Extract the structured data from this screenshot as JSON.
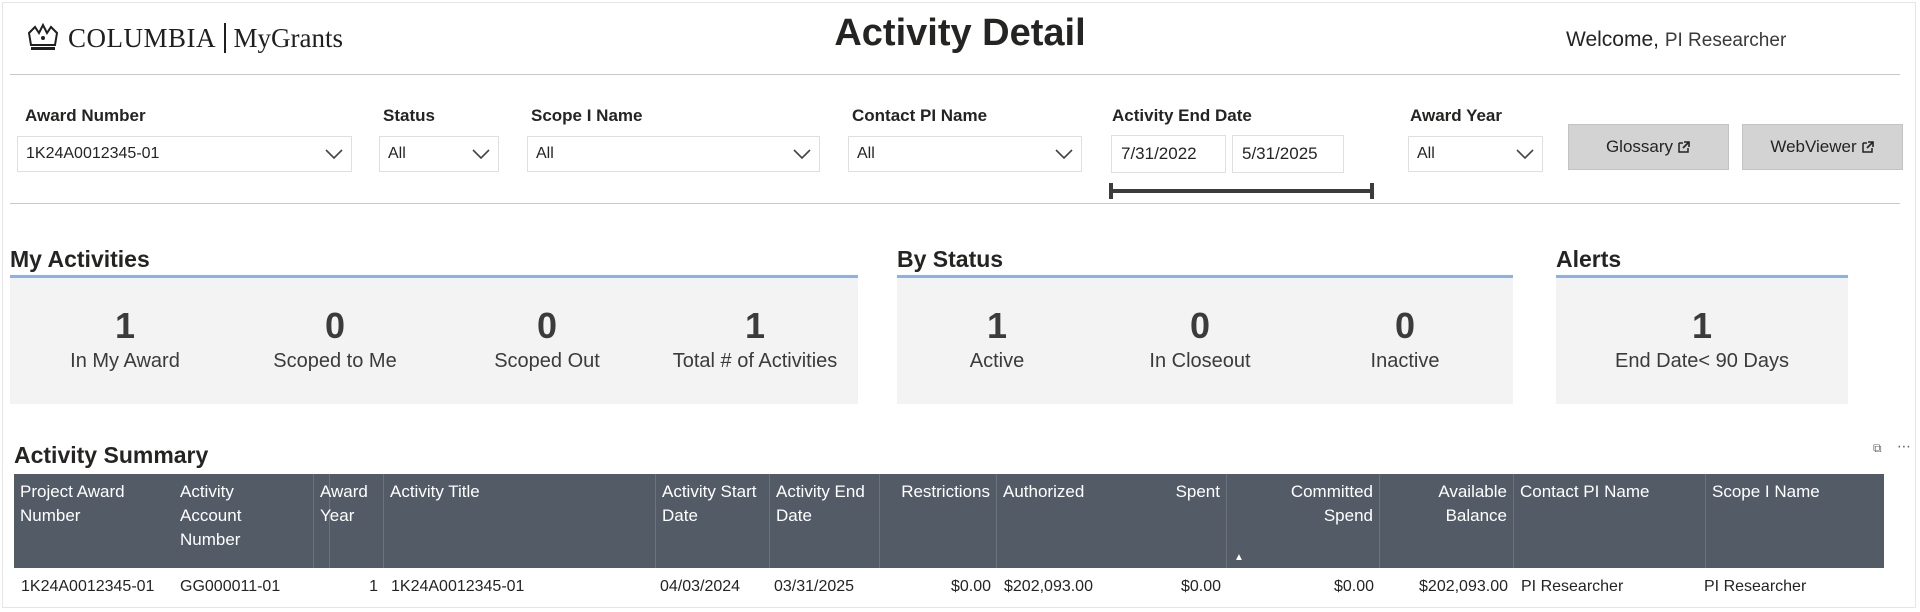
{
  "header": {
    "brand": "COLUMBIA",
    "product": "MyGrants",
    "title": "Activity Detail",
    "welcome": "Welcome,",
    "user": "PI Researcher"
  },
  "filters": {
    "award_number": {
      "label": "Award Number",
      "value": "1K24A0012345-01"
    },
    "status": {
      "label": "Status",
      "value": "All"
    },
    "scope_name": {
      "label": "Scope I Name",
      "value": "All"
    },
    "contact_pi": {
      "label": "Contact PI Name",
      "value": "All"
    },
    "activity_end_date": {
      "label": "Activity End Date",
      "start": "7/31/2022",
      "end": "5/31/2025"
    },
    "award_year": {
      "label": "Award Year",
      "value": "All"
    }
  },
  "buttons": {
    "glossary": "Glossary",
    "webviewer": "WebViewer"
  },
  "my_activities": {
    "title": "My Activities",
    "kpis": [
      {
        "value": "1",
        "label": "In My Award"
      },
      {
        "value": "0",
        "label": "Scoped to Me"
      },
      {
        "value": "0",
        "label": "Scoped Out"
      },
      {
        "value": "1",
        "label": "Total # of Activities"
      }
    ]
  },
  "by_status": {
    "title": "By Status",
    "kpis": [
      {
        "value": "1",
        "label": "Active"
      },
      {
        "value": "0",
        "label": "In Closeout"
      },
      {
        "value": "0",
        "label": "Inactive"
      }
    ]
  },
  "alerts": {
    "title": "Alerts",
    "kpis": [
      {
        "value": "1",
        "label": "End Date< 90 Days"
      }
    ]
  },
  "table": {
    "title": "Activity Summary",
    "columns": [
      "Project Award Number",
      "Activity Account Number",
      "Award Year",
      "Activity Title",
      "Activity Start Date",
      "Activity End Date",
      "Restrictions",
      "Authorized",
      "Spent",
      "Committed Spend",
      "Available Balance",
      "Contact PI Name",
      "Scope I Name"
    ],
    "rows": [
      [
        "1K24A0012345-01",
        "GG000011-01",
        "1",
        "1K24A0012345-01",
        "04/03/2024",
        "03/31/2025",
        "$0.00",
        "$202,093.00",
        "$0.00",
        "$0.00",
        "$202,093.00",
        "PI Researcher",
        "PI Researcher"
      ]
    ]
  }
}
